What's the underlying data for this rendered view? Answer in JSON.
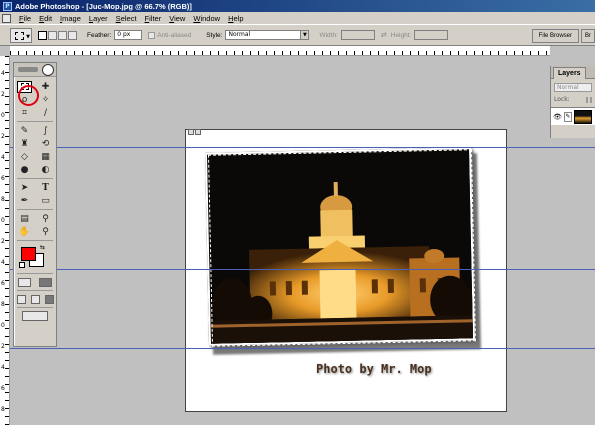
{
  "window": {
    "title": "Adobe Photoshop - [Juc-Mop.jpg @ 66.7% (RGB)]"
  },
  "menu": [
    "File",
    "Edit",
    "Image",
    "Layer",
    "Select",
    "Filter",
    "View",
    "Window",
    "Help"
  ],
  "options": {
    "feather_label": "Feather:",
    "feather_value": "0 px",
    "antialiased_label": "Anti-aliased",
    "style_label": "Style:",
    "style_value": "Normal",
    "width_label": "Width:",
    "height_label": "Height:"
  },
  "palette_well": {
    "tabs": [
      "File Browser",
      "Br"
    ]
  },
  "ruler_left_numbers": [
    "4",
    "2",
    "0",
    "2",
    "4",
    "6",
    "8",
    "0",
    "2",
    "4",
    "6",
    "8",
    "0",
    "2",
    "4",
    "6",
    "8"
  ],
  "toolbox": {
    "foreground_color": "#ff0000",
    "background_color": "#ffffff",
    "highlight_color": "#e00010"
  },
  "document": {
    "caption": "Photo by Mr. Mop"
  },
  "layers": {
    "tab_label": "Layers",
    "blend_mode": "Normal",
    "lock_label": "Lock:"
  },
  "guide_color": "#4a5fb8"
}
